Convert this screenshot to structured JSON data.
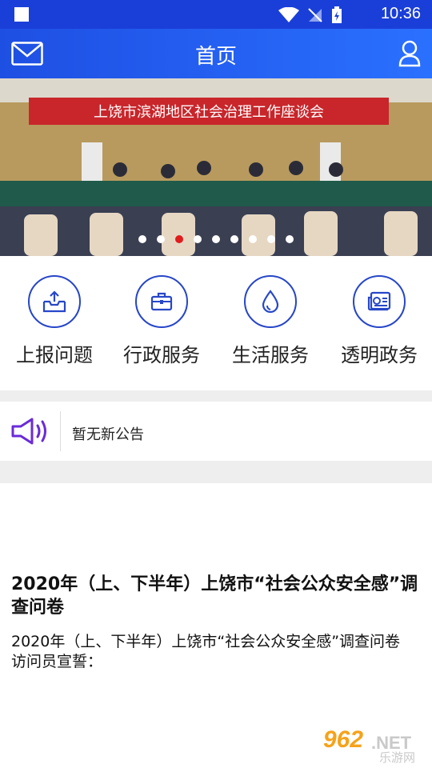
{
  "status_bar": {
    "time": "10:36"
  },
  "header": {
    "title": "首页"
  },
  "banner": {
    "headline": "上饶市滨湖地区社会治理工作座谈会",
    "slide_count": 9,
    "active_index": 2
  },
  "services": [
    {
      "label": "上报问题",
      "icon": "upload-tray-icon"
    },
    {
      "label": "行政服务",
      "icon": "briefcase-icon"
    },
    {
      "label": "生活服务",
      "icon": "water-drop-icon"
    },
    {
      "label": "透明政务",
      "icon": "newspaper-icon"
    }
  ],
  "notice": {
    "text": "暂无新公告"
  },
  "article": {
    "title": "2020年（上、下半年）上饶市“社会公众安全感”调查问卷",
    "body_line1": "2020年（上、下半年）上饶市“社会公众安全感”调查问卷",
    "body_line2": "访问员宣誓："
  },
  "watermark": {
    "brand": "962",
    "suffix": ".NET",
    "sub": "乐游网"
  },
  "colors": {
    "primary": "#2747c8",
    "appbar": "#1e4fe3",
    "active_dot": "#e01c1c",
    "notice_icon": "#6a2bd8"
  }
}
